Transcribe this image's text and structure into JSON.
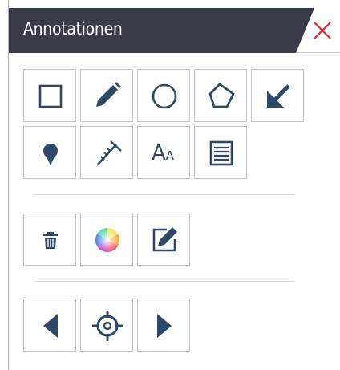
{
  "panel": {
    "title": "Annotationen",
    "title_bar_color": "#3a3b49",
    "close_color": "#e0262b"
  },
  "icon_color": "#2c4a68",
  "toolbar_draw": {
    "items": [
      {
        "icon": "rectangle-icon",
        "name": "rectangle-tool"
      },
      {
        "icon": "pencil-icon",
        "name": "pencil-tool"
      },
      {
        "icon": "circle-icon",
        "name": "circle-tool"
      },
      {
        "icon": "polygon-icon",
        "name": "polygon-tool"
      },
      {
        "icon": "arrow-icon",
        "name": "arrow-tool"
      },
      {
        "icon": "pin-icon",
        "name": "pin-tool"
      },
      {
        "icon": "measure-icon",
        "name": "measure-tool"
      },
      {
        "icon": "text-icon",
        "name": "text-tool",
        "label_big": "A",
        "label_small": "A"
      },
      {
        "icon": "note-icon",
        "name": "note-tool"
      }
    ]
  },
  "toolbar_edit": {
    "items": [
      {
        "icon": "trash-icon",
        "name": "delete-tool"
      },
      {
        "icon": "color-wheel-icon",
        "name": "color-tool"
      },
      {
        "icon": "edit-icon",
        "name": "edit-tool"
      }
    ]
  },
  "toolbar_nav": {
    "items": [
      {
        "icon": "chevron-left-icon",
        "name": "previous-button"
      },
      {
        "icon": "crosshair-icon",
        "name": "locate-button"
      },
      {
        "icon": "chevron-right-icon",
        "name": "next-button"
      }
    ]
  }
}
